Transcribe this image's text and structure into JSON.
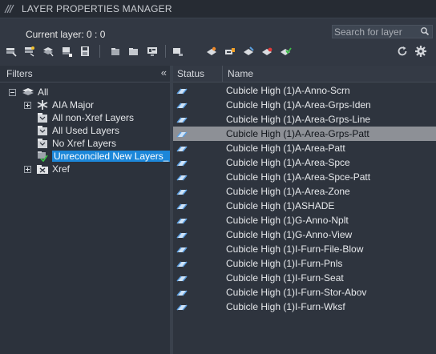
{
  "window": {
    "title": "LAYER PROPERTIES MANAGER"
  },
  "header": {
    "current_layer": "Current layer: 0 : 0",
    "search_placeholder": "Search for layer"
  },
  "toolbar": {
    "left_icons": [
      "new-property-filter-icon",
      "new-group-filter-icon",
      "layer-states-manager-icon",
      "new-layer-icon",
      "save-icon",
      "new-layer-vp-frozen-icon",
      "delete-layer-icon",
      "set-current-icon",
      "layer-settings-icon",
      "isolate-icon",
      "freeze-icon",
      "lock-icon",
      "unlock-icon",
      "visibility-icon",
      "refresh-icon",
      "settings-gear-icon"
    ]
  },
  "filters": {
    "label": "Filters",
    "collapse_glyph": "«",
    "tree": {
      "root": "All",
      "children": [
        {
          "label": "AIA Major",
          "expandable": true
        },
        {
          "label": "All non-Xref Layers"
        },
        {
          "label": "All Used Layers"
        },
        {
          "label": "No Xref Layers"
        },
        {
          "label": "Unreconciled New Layers_",
          "selected": true
        },
        {
          "label": "Xref",
          "expandable": true
        }
      ]
    }
  },
  "layers": {
    "columns": {
      "status": "Status",
      "name": "Name"
    },
    "selected_index": 3,
    "rows": [
      "Cubicle High (1)A-Anno-Scrn",
      "Cubicle High (1)A-Area-Grps-Iden",
      "Cubicle High (1)A-Area-Grps-Line",
      "Cubicle High (1)A-Area-Grps-Patt",
      "Cubicle High (1)A-Area-Patt",
      "Cubicle High (1)A-Area-Spce",
      "Cubicle High (1)A-Area-Spce-Patt",
      "Cubicle High (1)A-Area-Zone",
      "Cubicle High (1)ASHADE",
      "Cubicle High (1)G-Anno-Nplt",
      "Cubicle High (1)G-Anno-View",
      "Cubicle High (1)I-Furn-File-Blow",
      "Cubicle High (1)I-Furn-Pnls",
      "Cubicle High (1)I-Furn-Seat",
      "Cubicle High (1)I-Furn-Stor-Abov",
      "Cubicle High (1)I-Furn-Wksf"
    ]
  },
  "colors": {
    "selection_blue": "#1c87d9",
    "row_selected": "#8d9096",
    "panel_bg": "#2f3540"
  }
}
